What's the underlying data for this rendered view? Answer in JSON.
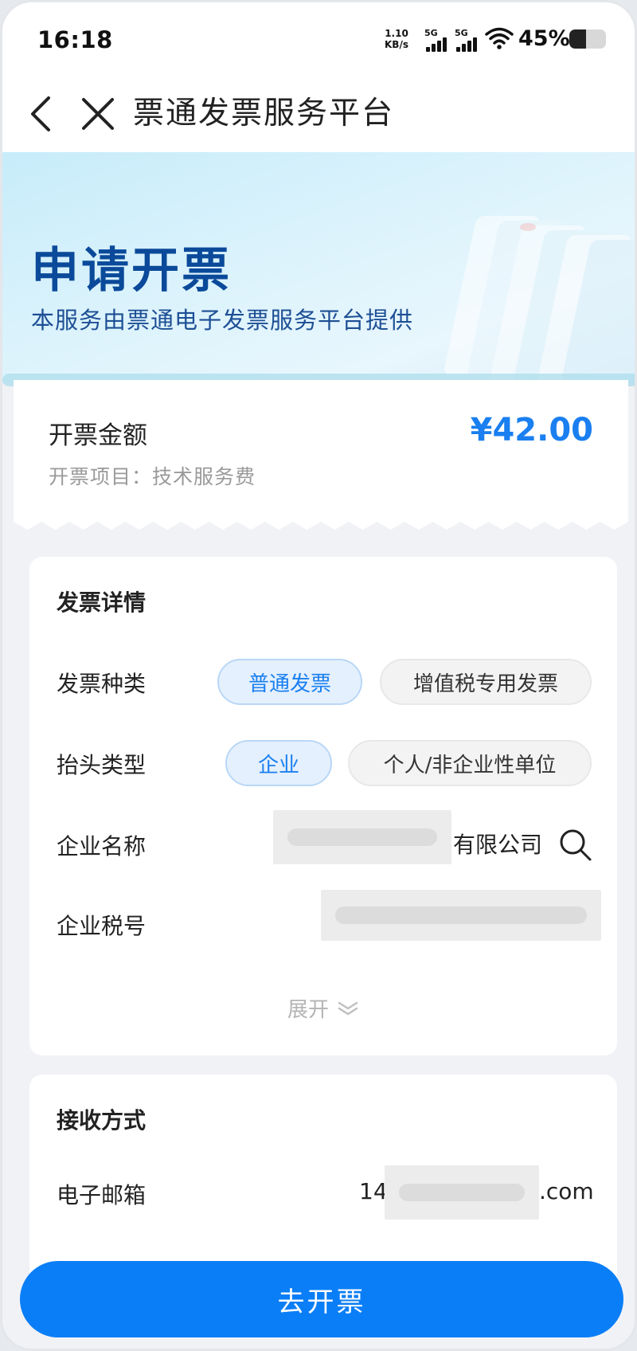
{
  "status_bar": {
    "time": "16:18",
    "net_speed_value": "1.10",
    "net_speed_unit": "KB/s",
    "signal_1_label": "5G",
    "signal_2_label": "5G",
    "battery_percent": "45%",
    "battery_level": 0.45
  },
  "nav": {
    "back_icon": "chevron-left-icon",
    "close_icon": "close-icon",
    "title": "票通发票服务平台"
  },
  "hero": {
    "title": "申请开票",
    "subtitle": "本服务由票通电子发票服务平台提供"
  },
  "amount": {
    "label": "开票金额",
    "value": "¥42.00",
    "item_line": "开票项目：技术服务费"
  },
  "details": {
    "title": "发票详情",
    "invoice_type": {
      "label": "发票种类",
      "options": [
        "普通发票",
        "增值税专用发票"
      ],
      "selected": "普通发票"
    },
    "header_type": {
      "label": "抬头类型",
      "options": [
        "企业",
        "个人/非企业性单位"
      ],
      "selected": "企业"
    },
    "company_name": {
      "label": "企业名称",
      "suffix": "有限公司",
      "search_icon": "search-icon"
    },
    "tax_id": {
      "label": "企业税号"
    },
    "expand_label": "展开",
    "expand_icon": "chevron-double-down-icon"
  },
  "receive": {
    "title": "接收方式",
    "email": {
      "label": "电子邮箱",
      "prefix": "14",
      "suffix": ".com"
    }
  },
  "submit_label": "去开票",
  "colors": {
    "accent": "#0a7ef6",
    "amount": "#1a7ff0",
    "hero_title": "#0b4a9a",
    "pill_active_bg": "#e4f0fd"
  }
}
